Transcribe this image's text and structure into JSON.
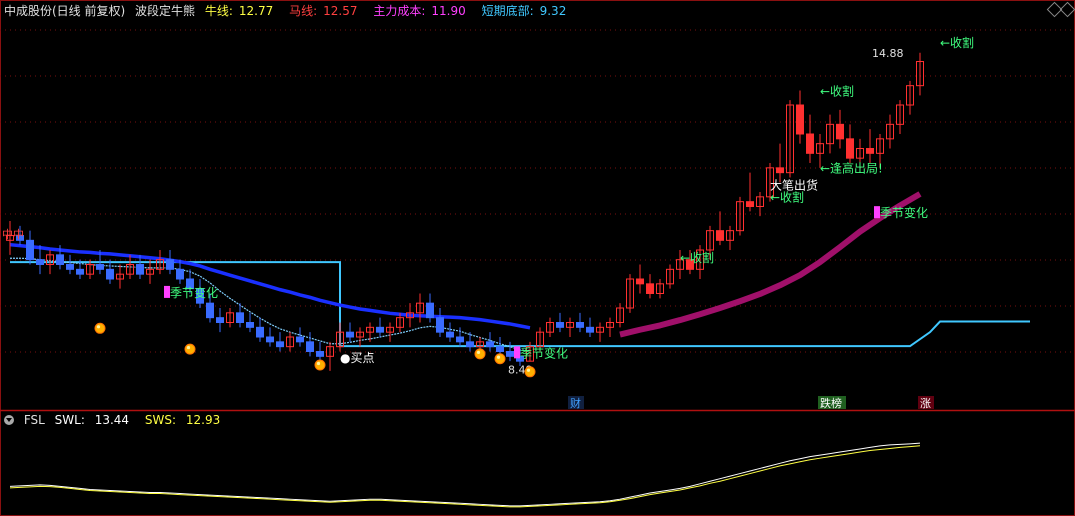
{
  "header": {
    "stock": "中成股份(日线 前复权)",
    "indicator": "波段定牛熊",
    "items": [
      {
        "label": "牛线:",
        "value": "12.77",
        "color": "#ffff44"
      },
      {
        "label": "马线:",
        "value": "12.57",
        "color": "#ff4040"
      },
      {
        "label": "主力成本:",
        "value": "11.90",
        "color": "#ff40ff"
      },
      {
        "label": "短期底部:",
        "value": "9.32",
        "color": "#40c8ff"
      }
    ]
  },
  "subpanel": {
    "name": "FSL",
    "items": [
      {
        "label": "SWL:",
        "value": "13.44",
        "color": "#ffffff"
      },
      {
        "label": "SWS:",
        "value": "12.93",
        "color": "#ffff44"
      }
    ]
  },
  "chart_data": {
    "type": "candlestick",
    "ylim": [
      7.8,
      15.6
    ],
    "price_labels": {
      "high": "14.88",
      "low": "8.49"
    },
    "candles": [
      [
        11.0,
        11.4,
        10.7,
        11.1
      ],
      [
        11.1,
        11.3,
        10.9,
        11.0
      ],
      [
        11.0,
        11.2,
        10.5,
        10.6
      ],
      [
        10.6,
        10.9,
        10.3,
        10.5
      ],
      [
        10.5,
        10.8,
        10.3,
        10.7
      ],
      [
        10.7,
        10.9,
        10.4,
        10.5
      ],
      [
        10.5,
        10.7,
        10.3,
        10.4
      ],
      [
        10.4,
        10.6,
        10.2,
        10.3
      ],
      [
        10.3,
        10.6,
        10.2,
        10.5
      ],
      [
        10.5,
        10.8,
        10.3,
        10.4
      ],
      [
        10.4,
        10.6,
        10.1,
        10.2
      ],
      [
        10.2,
        10.5,
        10.0,
        10.3
      ],
      [
        10.3,
        10.7,
        10.2,
        10.5
      ],
      [
        10.5,
        10.7,
        10.2,
        10.3
      ],
      [
        10.3,
        10.6,
        10.1,
        10.4
      ],
      [
        10.4,
        10.8,
        10.3,
        10.6
      ],
      [
        10.6,
        10.8,
        10.3,
        10.4
      ],
      [
        10.4,
        10.6,
        10.1,
        10.2
      ],
      [
        10.2,
        10.4,
        9.9,
        10.0
      ],
      [
        10.0,
        10.2,
        9.6,
        9.7
      ],
      [
        9.7,
        9.9,
        9.3,
        9.4
      ],
      [
        9.4,
        9.6,
        9.1,
        9.3
      ],
      [
        9.3,
        9.6,
        9.2,
        9.5
      ],
      [
        9.5,
        9.7,
        9.2,
        9.3
      ],
      [
        9.3,
        9.5,
        9.1,
        9.2
      ],
      [
        9.2,
        9.4,
        8.9,
        9.0
      ],
      [
        9.0,
        9.2,
        8.8,
        8.9
      ],
      [
        8.9,
        9.1,
        8.7,
        8.8
      ],
      [
        8.8,
        9.1,
        8.7,
        9.0
      ],
      [
        9.0,
        9.2,
        8.8,
        8.9
      ],
      [
        8.9,
        9.1,
        8.6,
        8.7
      ],
      [
        8.7,
        8.9,
        8.5,
        8.6
      ],
      [
        8.6,
        8.9,
        8.3,
        8.8
      ],
      [
        8.8,
        9.3,
        8.7,
        9.1
      ],
      [
        9.1,
        9.3,
        8.9,
        9.0
      ],
      [
        9.0,
        9.2,
        8.8,
        9.1
      ],
      [
        9.1,
        9.3,
        8.9,
        9.2
      ],
      [
        9.2,
        9.4,
        9.0,
        9.1
      ],
      [
        9.1,
        9.3,
        8.9,
        9.2
      ],
      [
        9.2,
        9.5,
        9.1,
        9.4
      ],
      [
        9.4,
        9.7,
        9.2,
        9.5
      ],
      [
        9.5,
        9.9,
        9.3,
        9.7
      ],
      [
        9.7,
        9.9,
        9.3,
        9.4
      ],
      [
        9.4,
        9.6,
        9.0,
        9.1
      ],
      [
        9.1,
        9.3,
        8.9,
        9.0
      ],
      [
        9.0,
        9.2,
        8.8,
        8.9
      ],
      [
        8.9,
        9.1,
        8.7,
        8.8
      ],
      [
        8.8,
        9.0,
        8.6,
        8.9
      ],
      [
        8.9,
        9.1,
        8.7,
        8.8
      ],
      [
        8.8,
        9.0,
        8.6,
        8.7
      ],
      [
        8.7,
        8.9,
        8.5,
        8.6
      ],
      [
        8.6,
        8.8,
        8.4,
        8.5
      ],
      [
        8.5,
        8.9,
        8.49,
        8.8
      ],
      [
        8.8,
        9.2,
        8.7,
        9.1
      ],
      [
        9.1,
        9.4,
        9.0,
        9.3
      ],
      [
        9.3,
        9.5,
        9.1,
        9.2
      ],
      [
        9.2,
        9.4,
        9.0,
        9.3
      ],
      [
        9.3,
        9.5,
        9.1,
        9.2
      ],
      [
        9.2,
        9.4,
        9.0,
        9.1
      ],
      [
        9.1,
        9.3,
        8.9,
        9.2
      ],
      [
        9.2,
        9.4,
        9.0,
        9.3
      ],
      [
        9.3,
        9.7,
        9.2,
        9.6
      ],
      [
        9.6,
        10.3,
        9.5,
        10.2
      ],
      [
        10.2,
        10.5,
        9.9,
        10.1
      ],
      [
        10.1,
        10.3,
        9.8,
        9.9
      ],
      [
        9.9,
        10.2,
        9.8,
        10.1
      ],
      [
        10.1,
        10.5,
        10.0,
        10.4
      ],
      [
        10.4,
        10.8,
        10.2,
        10.6
      ],
      [
        10.6,
        10.8,
        10.3,
        10.4
      ],
      [
        10.4,
        10.9,
        10.2,
        10.8
      ],
      [
        10.8,
        11.3,
        10.6,
        11.2
      ],
      [
        11.2,
        11.6,
        10.9,
        11.0
      ],
      [
        11.0,
        11.3,
        10.8,
        11.2
      ],
      [
        11.2,
        11.9,
        11.1,
        11.8
      ],
      [
        11.8,
        12.4,
        11.6,
        11.7
      ],
      [
        11.7,
        12.0,
        11.5,
        11.9
      ],
      [
        11.9,
        12.6,
        11.8,
        12.5
      ],
      [
        12.5,
        13.0,
        12.2,
        12.4
      ],
      [
        12.4,
        13.9,
        12.3,
        13.8
      ],
      [
        13.8,
        14.1,
        13.0,
        13.2
      ],
      [
        13.2,
        13.6,
        12.6,
        12.8
      ],
      [
        12.8,
        13.2,
        12.5,
        13.0
      ],
      [
        13.0,
        13.6,
        12.8,
        13.4
      ],
      [
        13.4,
        13.7,
        12.9,
        13.1
      ],
      [
        13.1,
        13.4,
        12.6,
        12.7
      ],
      [
        12.7,
        13.1,
        12.5,
        12.9
      ],
      [
        12.9,
        13.3,
        12.6,
        12.8
      ],
      [
        12.8,
        13.2,
        12.5,
        13.1
      ],
      [
        13.1,
        13.6,
        12.9,
        13.4
      ],
      [
        13.4,
        13.9,
        13.2,
        13.8
      ],
      [
        13.8,
        14.3,
        13.6,
        14.2
      ],
      [
        14.2,
        14.88,
        14.0,
        14.7
      ]
    ],
    "long_ma": [
      10.91,
      10.89,
      10.87,
      10.85,
      10.82,
      10.8,
      10.78,
      10.76,
      10.75,
      10.73,
      10.72,
      10.7,
      10.68,
      10.66,
      10.64,
      10.62,
      10.59,
      10.56,
      10.52,
      10.47,
      10.4,
      10.34,
      10.28,
      10.22,
      10.16,
      10.1,
      10.04,
      9.98,
      9.93,
      9.87,
      9.82,
      9.76,
      9.71,
      9.66,
      9.62,
      9.58,
      9.55,
      9.52,
      9.49,
      9.47,
      9.45,
      9.44,
      9.43,
      9.42,
      9.41,
      9.4,
      9.38,
      9.36,
      9.33,
      9.3,
      9.27,
      9.23,
      9.19
    ],
    "ma_short_a": [
      10.63,
      10.63,
      10.62,
      10.6,
      10.58,
      10.56,
      10.54,
      10.52,
      10.5,
      10.48,
      10.47,
      10.46,
      10.45,
      10.44,
      10.43,
      10.43,
      10.43,
      10.4,
      10.35,
      10.26,
      10.12,
      9.95,
      9.8,
      9.66,
      9.52,
      9.39,
      9.27,
      9.17,
      9.1,
      9.04,
      8.98,
      8.92,
      8.86,
      8.86,
      8.89,
      8.93,
      8.96,
      9.0,
      9.04,
      9.08,
      9.13,
      9.19,
      9.22,
      9.2,
      9.16,
      9.12,
      9.05,
      8.99,
      8.93,
      8.86,
      8.8,
      8.73,
      8.72
    ],
    "bull_band": [
      [
        61,
        9.05
      ],
      [
        63,
        9.15
      ],
      [
        65,
        9.24
      ],
      [
        67,
        9.35
      ],
      [
        69,
        9.47
      ],
      [
        71,
        9.6
      ],
      [
        73,
        9.74
      ],
      [
        75,
        9.89
      ],
      [
        77,
        10.07
      ],
      [
        79,
        10.28
      ],
      [
        81,
        10.55
      ],
      [
        83,
        10.86
      ],
      [
        85,
        11.18
      ],
      [
        87,
        11.46
      ],
      [
        89,
        11.72
      ],
      [
        91,
        11.96
      ]
    ],
    "short_bottom": [
      [
        0,
        10.55
      ],
      [
        33,
        10.55
      ],
      [
        33,
        8.81
      ],
      [
        90,
        8.81
      ],
      [
        92,
        9.1
      ],
      [
        93,
        9.32
      ],
      [
        102,
        9.32
      ]
    ],
    "fsl": {
      "ylim": [
        0,
        16
      ],
      "swl": [
        5.0,
        5.1,
        5.2,
        5.3,
        5.2,
        5.0,
        4.8,
        4.6,
        4.4,
        4.3,
        4.2,
        4.1,
        4.0,
        3.9,
        3.8,
        3.8,
        3.7,
        3.6,
        3.5,
        3.4,
        3.3,
        3.2,
        3.1,
        3.0,
        2.9,
        2.8,
        2.7,
        2.6,
        2.5,
        2.4,
        2.3,
        2.2,
        2.1,
        2.2,
        2.3,
        2.4,
        2.5,
        2.5,
        2.4,
        2.3,
        2.2,
        2.1,
        2.0,
        1.9,
        1.8,
        1.7,
        1.6,
        1.5,
        1.4,
        1.3,
        1.2,
        1.2,
        1.3,
        1.4,
        1.5,
        1.6,
        1.7,
        1.8,
        1.9,
        2.0,
        2.2,
        2.5,
        2.9,
        3.3,
        3.7,
        4.0,
        4.3,
        4.6,
        5.0,
        5.5,
        6.0,
        6.5,
        7.0,
        7.5,
        8.0,
        8.5,
        9.0,
        9.5,
        10.0,
        10.4,
        10.8,
        11.1,
        11.4,
        11.7,
        12.0,
        12.3,
        12.6,
        12.9,
        13.1,
        13.2,
        13.3,
        13.44
      ],
      "sws": [
        4.7,
        4.8,
        4.9,
        5.0,
        4.95,
        4.8,
        4.6,
        4.4,
        4.2,
        4.1,
        4.0,
        3.9,
        3.8,
        3.7,
        3.6,
        3.6,
        3.5,
        3.4,
        3.3,
        3.2,
        3.1,
        3.0,
        2.9,
        2.8,
        2.7,
        2.6,
        2.5,
        2.4,
        2.3,
        2.2,
        2.1,
        2.0,
        1.9,
        2.0,
        2.1,
        2.2,
        2.3,
        2.3,
        2.2,
        2.1,
        2.0,
        1.9,
        1.8,
        1.7,
        1.6,
        1.5,
        1.4,
        1.3,
        1.2,
        1.1,
        1.0,
        1.0,
        1.1,
        1.2,
        1.3,
        1.4,
        1.5,
        1.6,
        1.7,
        1.8,
        2.0,
        2.3,
        2.6,
        3.0,
        3.4,
        3.7,
        4.0,
        4.3,
        4.7,
        5.1,
        5.6,
        6.0,
        6.5,
        7.0,
        7.5,
        8.0,
        8.5,
        9.0,
        9.4,
        9.8,
        10.2,
        10.5,
        10.8,
        11.1,
        11.4,
        11.7,
        12.0,
        12.2,
        12.4,
        12.6,
        12.75,
        12.93
      ]
    }
  },
  "annotations": [
    {
      "text": "季节变化",
      "i": 16,
      "price": 9.85,
      "color": "#ff40ff",
      "text_color": "#40ff80"
    },
    {
      "text": "季节变化",
      "i": 51,
      "price": 8.6,
      "color": "#ff40ff",
      "text_color": "#40ff80"
    },
    {
      "text": "季节变化",
      "i": 87,
      "price": 11.5,
      "color": "#ff40ff",
      "text_color": "#40ff80"
    },
    {
      "text": "●买点",
      "i": 33,
      "price": 8.48,
      "color": "#ffffff",
      "text_color": "#ffffff"
    },
    {
      "text": "←收割",
      "i": 67,
      "price": 10.55,
      "color": "#40ff80",
      "text_color": "#40ff80"
    },
    {
      "text": "←收割",
      "i": 76,
      "price": 11.8,
      "color": "#40ff80",
      "text_color": "#40ff80"
    },
    {
      "text": "←收割",
      "i": 81,
      "price": 14.0,
      "color": "#40ff80",
      "text_color": "#40ff80"
    },
    {
      "text": "←收割",
      "i": 93,
      "price": 15.0,
      "color": "#40ff80",
      "text_color": "#40ff80"
    },
    {
      "text": "大笔出货",
      "i": 76,
      "price": 12.05,
      "color": "#ffffff",
      "text_color": "#ffffff"
    },
    {
      "text": "←逢高出局!",
      "i": 81,
      "price": 12.4,
      "color": "#40ff80",
      "text_color": "#40ff80"
    }
  ],
  "coins": [
    [
      9,
      9.18
    ],
    [
      18,
      8.75
    ],
    [
      31,
      8.42
    ],
    [
      47,
      8.65
    ],
    [
      49,
      8.55
    ],
    [
      52,
      8.28
    ]
  ],
  "badges": [
    {
      "text": "财",
      "i": 56,
      "color": "#40a0ff",
      "bg": "#102040"
    },
    {
      "text": "跌榜",
      "i": 81,
      "color": "#ffffff",
      "bg": "#206020"
    },
    {
      "text": "涨",
      "i": 91,
      "color": "#ffffff",
      "bg": "#600010"
    }
  ],
  "left_marker": {
    "text": "中中",
    "price": 11.05,
    "color": "#ff4040"
  }
}
